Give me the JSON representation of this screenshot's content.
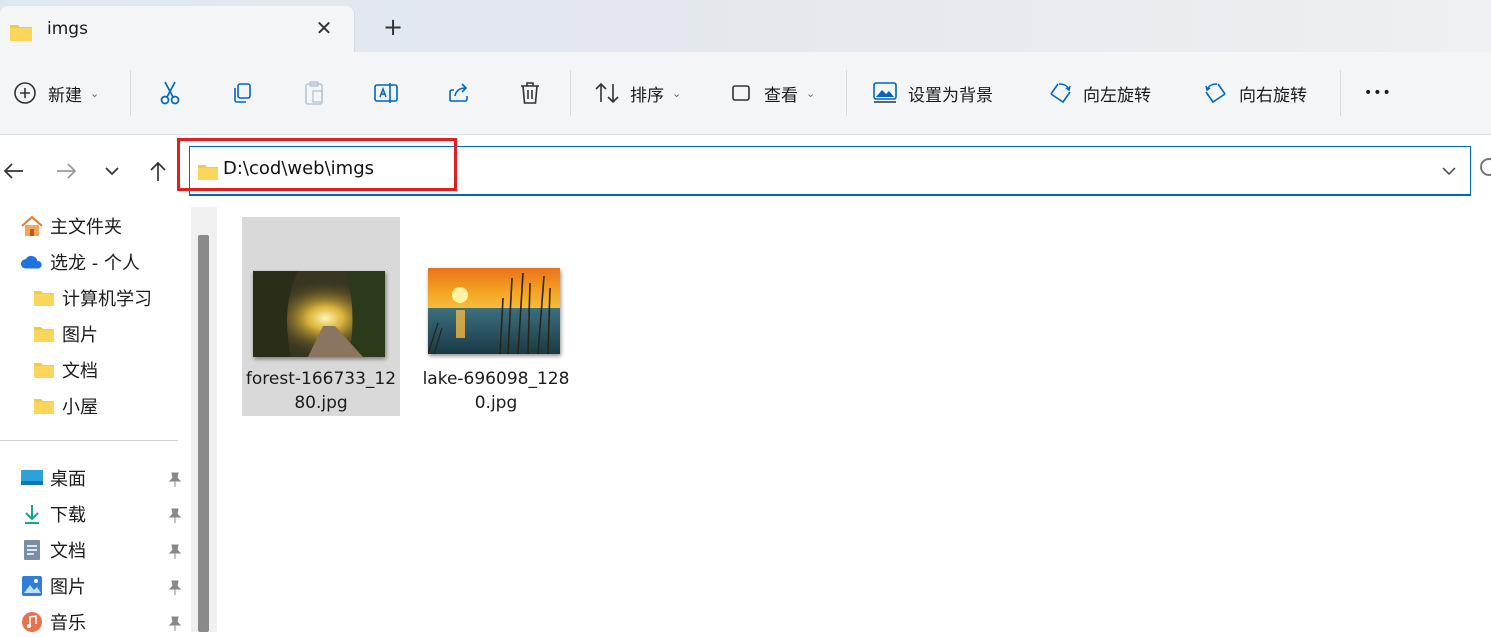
{
  "tab": {
    "title": "imgs",
    "close": "✕",
    "new_tab": "+"
  },
  "toolbar": {
    "new_label": "新建",
    "sort_label": "排序",
    "view_label": "查看",
    "set_background_label": "设置为背景",
    "rotate_left_label": "向左旋转",
    "rotate_right_label": "向右旋转",
    "more": "•••"
  },
  "address": {
    "path": "D:\\cod\\web\\imgs"
  },
  "nav": {
    "top_items": [
      {
        "label": "主文件夹",
        "icon": "home-icon"
      },
      {
        "label": "选龙 - 个人",
        "icon": "onedrive-cloud-icon"
      },
      {
        "label": "计算机学习",
        "icon": "folder-icon"
      },
      {
        "label": "图片",
        "icon": "folder-icon"
      },
      {
        "label": "文档",
        "icon": "folder-icon"
      },
      {
        "label": "小屋",
        "icon": "folder-icon"
      }
    ],
    "quick_access": [
      {
        "label": "桌面",
        "icon": "desktop-icon"
      },
      {
        "label": "下载",
        "icon": "download-icon"
      },
      {
        "label": "文档",
        "icon": "documents-icon"
      },
      {
        "label": "图片",
        "icon": "pictures-icon"
      },
      {
        "label": "音乐",
        "icon": "music-icon"
      }
    ]
  },
  "files": [
    {
      "name": "forest-166733_1280.jpg",
      "selected": true
    },
    {
      "name": "lake-696098_1280.jpg",
      "selected": false
    }
  ],
  "colors": {
    "accent": "#0067c0",
    "highlight": "#e02020",
    "folder": "#f6c945"
  }
}
